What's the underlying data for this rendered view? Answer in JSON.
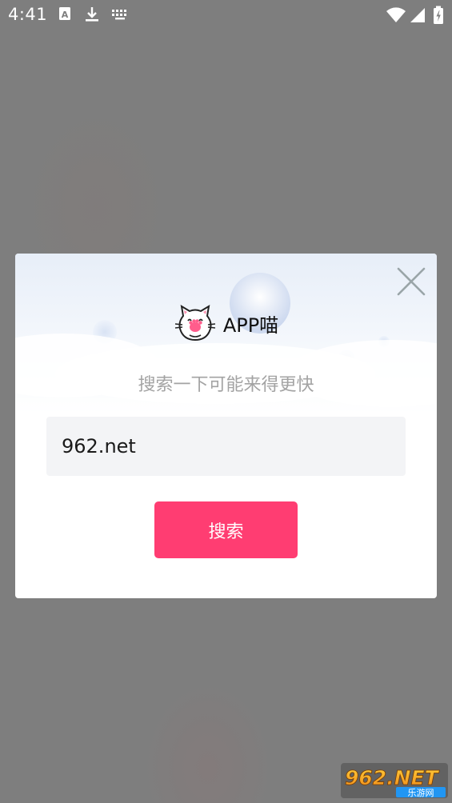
{
  "status_bar": {
    "time": "4:41",
    "icons": [
      "a-notification-icon",
      "download-icon",
      "keyboard-icon",
      "wifi-icon",
      "signal-icon",
      "battery-icon"
    ]
  },
  "dialog": {
    "app_name": "APP喵",
    "hint": "搜索一下可能来得更快",
    "search_value": "962.net",
    "search_button_label": "搜索",
    "close_icon": "close-icon",
    "logo_icon": "cat-logo-icon"
  },
  "watermark": {
    "brand": "962.NET",
    "tagline": "乐游网"
  },
  "colors": {
    "overlay": "#808080",
    "accent": "#ff3d72",
    "input_bg": "#f3f4f6",
    "hint_text": "#a3a3a3"
  }
}
